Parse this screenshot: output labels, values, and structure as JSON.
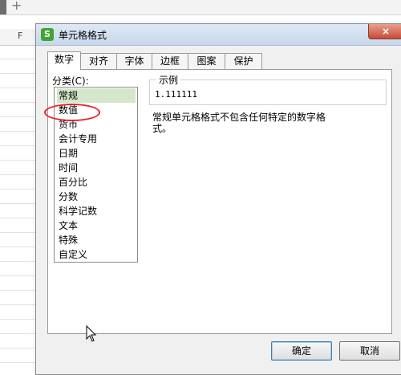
{
  "sheet": {
    "plus": "+",
    "column_letter": "F"
  },
  "dialog": {
    "icon_letter": "S",
    "title": "单元格格式",
    "close": "×",
    "tabs": [
      {
        "label": "数字",
        "active": true
      },
      {
        "label": "对齐"
      },
      {
        "label": "字体"
      },
      {
        "label": "边框"
      },
      {
        "label": "图案"
      },
      {
        "label": "保护"
      }
    ],
    "category_label": "分类(C):",
    "categories": [
      "常规",
      "数值",
      "货币",
      "会计专用",
      "日期",
      "时间",
      "百分比",
      "分数",
      "科学记数",
      "文本",
      "特殊",
      "自定义"
    ],
    "selected_category": "常规",
    "sample_legend": "示例",
    "sample_value": "1.111111",
    "description": "常规单元格格式不包含任何特定的数字格式。",
    "ok": "确定",
    "cancel": "取消"
  },
  "colors": {
    "selected_item": "#d4e7ca",
    "annotation": "#e8232a",
    "app_icon": "#3fa535"
  }
}
